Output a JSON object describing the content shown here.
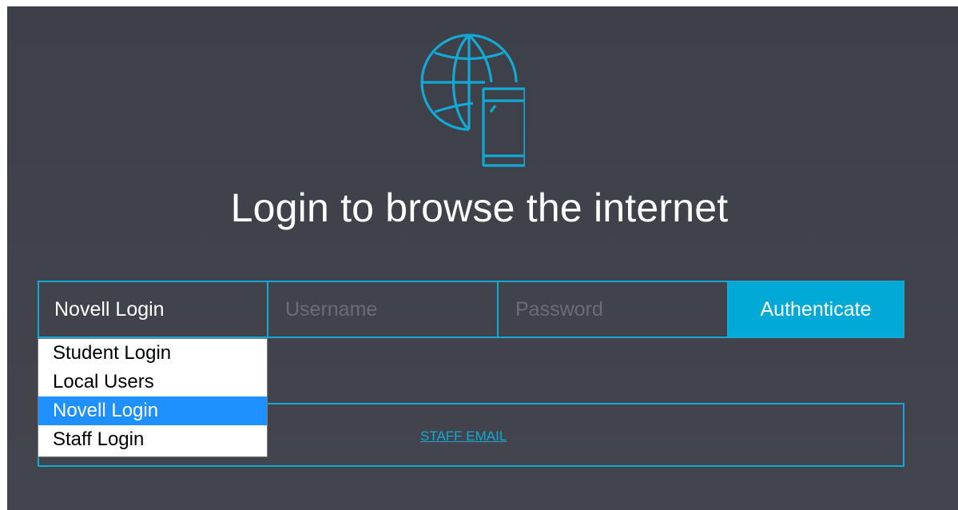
{
  "page": {
    "title": "Login to browse the internet"
  },
  "login_form": {
    "login_type_selected": "Novell Login",
    "username_placeholder": "Username",
    "password_placeholder": "Password",
    "authenticate_label": "Authenticate"
  },
  "login_type_dropdown": {
    "options": [
      {
        "label": "Student Login",
        "selected": false
      },
      {
        "label": "Local Users",
        "selected": false
      },
      {
        "label": "Novell Login",
        "selected": true
      },
      {
        "label": "Staff Login",
        "selected": false
      }
    ]
  },
  "links": {
    "staff_email": "STAFF EMAIL"
  },
  "icons": {
    "logo": "globe-with-mobile-phone-icon"
  },
  "colors": {
    "background": "#3f414b",
    "accent": "#12a9d4",
    "button": "#00a9d6",
    "selected_option": "#1e90ff"
  }
}
